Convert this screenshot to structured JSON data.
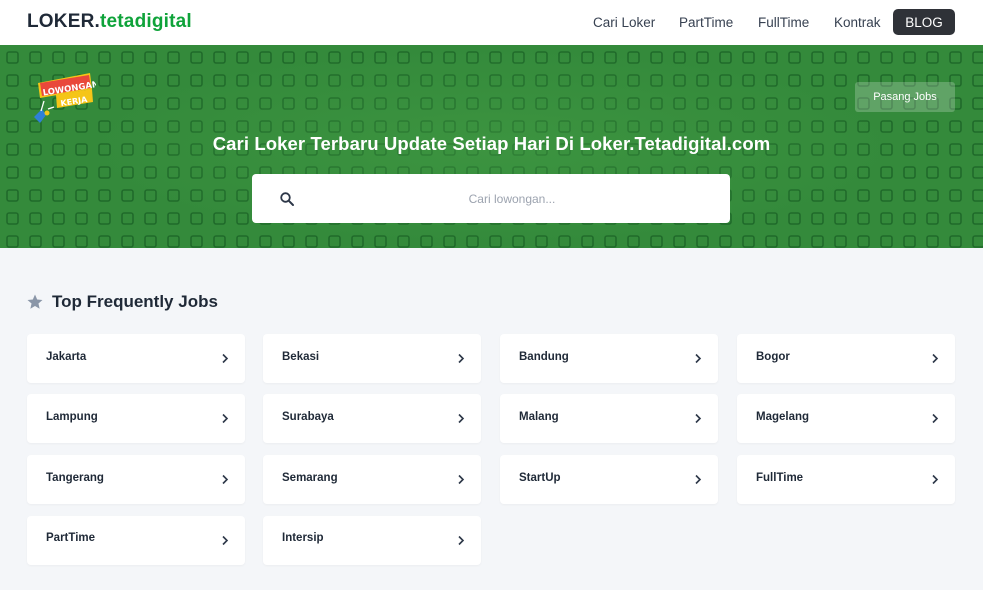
{
  "navbar": {
    "brand_part1": "LOKER.",
    "brand_part2": "tetadigital",
    "links": [
      "Cari Loker",
      "PartTime",
      "FullTime",
      "Kontrak"
    ],
    "blog_label": "BLOG"
  },
  "hero": {
    "badge_line1": "LOWONGAN",
    "badge_line2": "KERJA",
    "post_button": "Pasang Jobs",
    "title": "Cari Loker Terbaru Update Setiap Hari Di Loker.Tetadigital.com",
    "search_placeholder": "Cari lowongan..."
  },
  "section": {
    "title": "Top Frequently Jobs",
    "title_icon": "star-icon",
    "cards": [
      "Jakarta",
      "Bekasi",
      "Bandung",
      "Bogor",
      "Lampung",
      "Surabaya",
      "Malang",
      "Magelang",
      "Tangerang",
      "Semarang",
      "StartUp",
      "FullTime",
      "PartTime",
      "Intersip"
    ],
    "card_icon": "chevron-right-icon"
  },
  "colors": {
    "brand_green": "#0fa33a",
    "hero_green": "#348a3b",
    "blog_button": "#2f3238",
    "page_background": "#f4f6f9"
  }
}
